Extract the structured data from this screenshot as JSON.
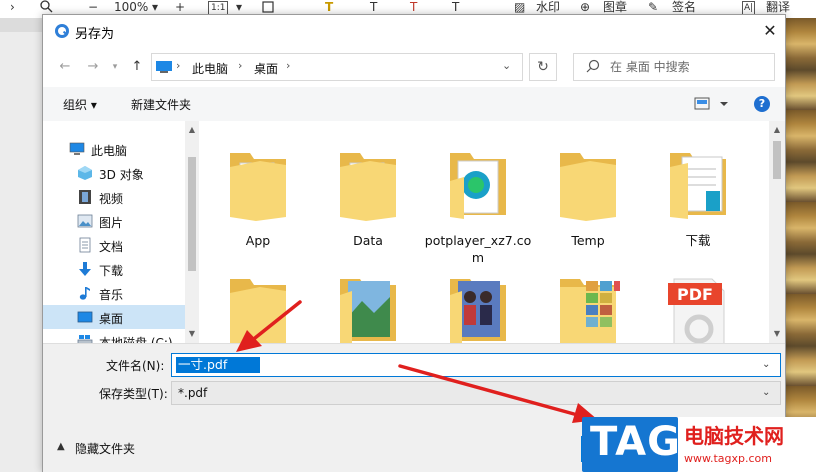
{
  "app_toolbar": {
    "zoom": "100%",
    "ratio": "1:1",
    "watermark_label": "水印",
    "stamp_label": "图章",
    "sign_label": "签名",
    "translate_label": "翻译"
  },
  "dialog": {
    "title": "另存为",
    "close_glyph": "✕",
    "address": {
      "segments": [
        "此电脑",
        "桌面"
      ]
    },
    "search_placeholder": "在 桌面 中搜索",
    "commands": {
      "organize": "组织 ▾",
      "new_folder": "新建文件夹"
    },
    "help": "?",
    "tree": [
      {
        "label": "此电脑",
        "icon": "computer-icon"
      },
      {
        "label": "3D 对象",
        "icon": "3d-objects-icon"
      },
      {
        "label": "视频",
        "icon": "video-icon"
      },
      {
        "label": "图片",
        "icon": "pictures-icon"
      },
      {
        "label": "文档",
        "icon": "documents-icon"
      },
      {
        "label": "下载",
        "icon": "download-icon"
      },
      {
        "label": "音乐",
        "icon": "music-icon"
      },
      {
        "label": "桌面",
        "icon": "desktop-icon",
        "selected": true
      },
      {
        "label": "本地磁盘 (C:)",
        "icon": "drive-icon"
      }
    ],
    "files": [
      {
        "label": "App",
        "icon": "folder-icon"
      },
      {
        "label": "Data",
        "icon": "folder-icon"
      },
      {
        "label": "potplayer_xz7.com",
        "icon": "folder-app-icon"
      },
      {
        "label": "Temp",
        "icon": "folder-icon"
      },
      {
        "label": "下载",
        "icon": "folder-docs-icon"
      },
      {
        "label": "",
        "icon": "folder-icon"
      },
      {
        "label": "",
        "icon": "folder-landscape-icon"
      },
      {
        "label": "",
        "icon": "folder-photo-icon"
      },
      {
        "label": "",
        "icon": "folder-thumbnails-icon"
      },
      {
        "label": "PDF",
        "icon": "pdf-file-icon"
      }
    ],
    "filename_label": "文件名(N):",
    "filename_value": "一寸.pdf",
    "filetype_label": "保存类型(T):",
    "filetype_value": "*.pdf",
    "hide_folders": "隐藏文件夹"
  },
  "watermark": {
    "logo": "TAG",
    "site_name": "电脑技术网",
    "url": "www.tagxp.com"
  },
  "colors": {
    "accent": "#0078d7",
    "selection_bg": "#cce4f7",
    "folder": "#f8d775",
    "arrow": "#e0201e"
  }
}
